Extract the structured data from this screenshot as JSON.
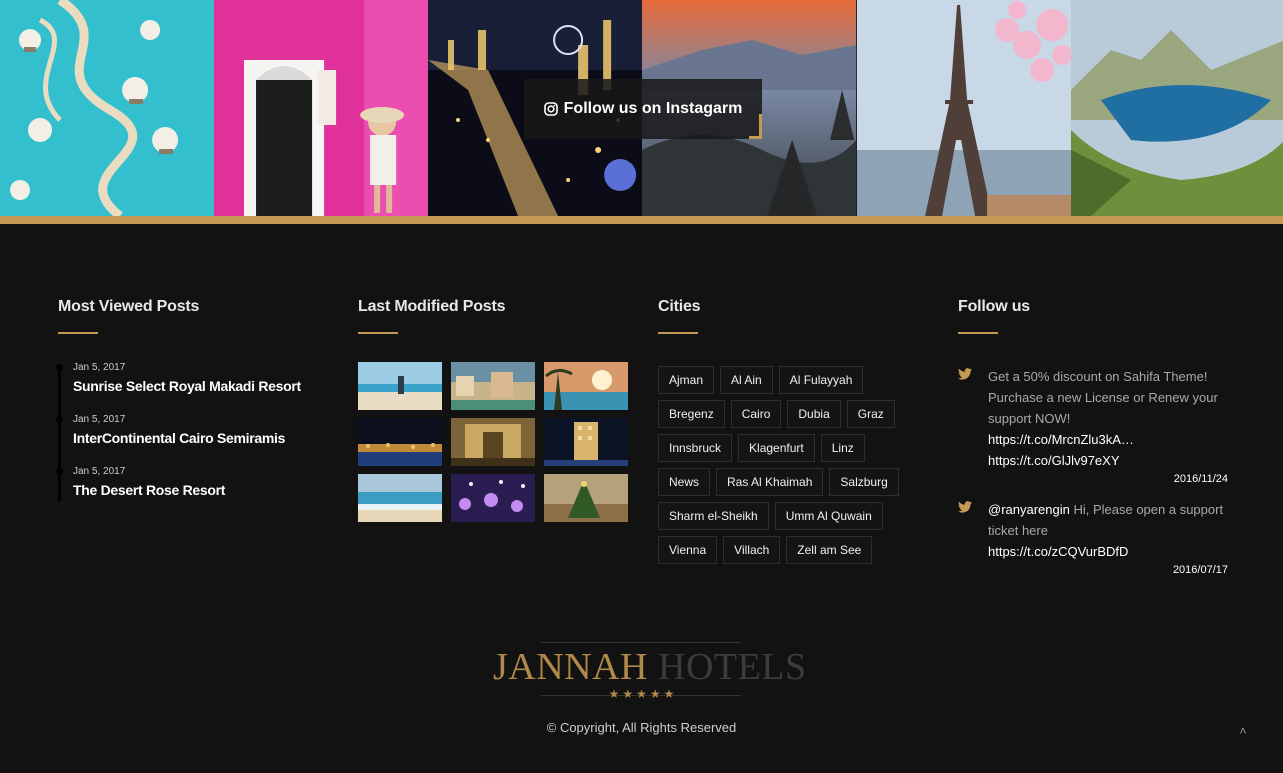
{
  "instagram": {
    "follow_label": "Follow us on Instagarm",
    "tiles": [
      {
        "name": "overwater-villas"
      },
      {
        "name": "pink-wall-door"
      },
      {
        "name": "city-night"
      },
      {
        "name": "temple-sunset"
      },
      {
        "name": "eiffel-tower"
      },
      {
        "name": "coastal-cliffs"
      }
    ],
    "accent": "#c49a52"
  },
  "footer": {
    "most_viewed": {
      "title": "Most Viewed Posts",
      "items": [
        {
          "date": "Jan 5, 2017",
          "title": "Sunrise Select Royal Makadi Resort"
        },
        {
          "date": "Jan 5, 2017",
          "title": "InterContinental Cairo Semiramis"
        },
        {
          "date": "Jan 5, 2017",
          "title": "The Desert Rose Resort"
        }
      ]
    },
    "last_modified": {
      "title": "Last Modified Posts",
      "thumbs": [
        "beach-family",
        "harbor-town",
        "palm-pool",
        "night-lights",
        "hotel-interior",
        "tower-night",
        "shore-waves",
        "event-hall",
        "pine-tree"
      ]
    },
    "cities": {
      "title": "Cities",
      "tags": [
        "Ajman",
        "Al Ain",
        "Al Fulayyah",
        "Bregenz",
        "Cairo",
        "Dubia",
        "Graz",
        "Innsbruck",
        "Klagenfurt",
        "Linz",
        "News",
        "Ras Al Khaimah",
        "Salzburg",
        "Sharm el-Sheikh",
        "Umm Al Quwain",
        "Vienna",
        "Villach",
        "Zell am See"
      ]
    },
    "follow_us": {
      "title": "Follow us",
      "tweets": [
        {
          "text": "Get a 50% discount on Sahifa Theme! Purchase a new License or Renew your support NOW!",
          "links": [
            "https://t.co/MrcnZlu3kA…",
            "https://t.co/GlJlv97eXY"
          ],
          "date": "2016/11/24"
        },
        {
          "user": "@ranyarengin",
          "text": " Hi, Please open a support ticket here",
          "links": [
            "https://t.co/zCQVurBDfD"
          ],
          "date": "2016/07/17"
        }
      ]
    }
  },
  "brand": {
    "name_a": "JANNAH",
    "name_b": " HOTELS",
    "stars": "★★★★★"
  },
  "copyright": "© Copyright, All Rights Reserved",
  "back_to_top": "˄"
}
